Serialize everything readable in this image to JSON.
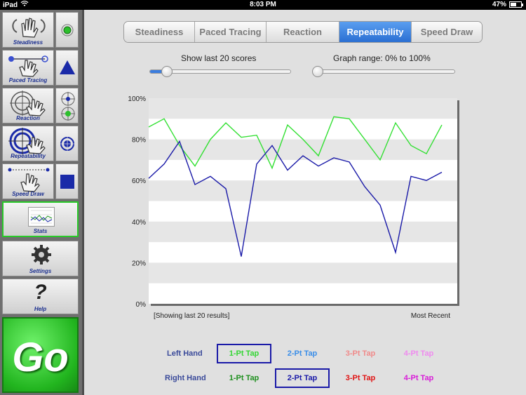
{
  "statusbar": {
    "device": "iPad",
    "time": "8:03 PM",
    "battery": "47%",
    "battery_level": 0.47
  },
  "sidebar": {
    "steadiness_label": "Steadiness",
    "paced_tracing_label": "Paced Tracing",
    "reaction_label": "Reaction",
    "repeatability_label": "Repeatability",
    "speed_draw_label": "Speed Draw",
    "stats_label": "Stats",
    "settings_label": "Settings",
    "help_label": "Help",
    "help_glyph": "?",
    "go_label": "Go"
  },
  "tabs": [
    {
      "label": "Steadiness",
      "active": false
    },
    {
      "label": "Paced Tracing",
      "active": false
    },
    {
      "label": "Reaction",
      "active": false
    },
    {
      "label": "Repeatability",
      "active": true
    },
    {
      "label": "Speed Draw",
      "active": false
    }
  ],
  "sliders": {
    "scores": {
      "label": "Show last 20 scores",
      "value": 0.12
    },
    "range": {
      "label": "Graph range: 0% to 100%",
      "value": 0.0
    }
  },
  "chart_data": {
    "type": "line",
    "ylim": [
      0,
      100
    ],
    "y_ticks": [
      "0%",
      "20%",
      "40%",
      "60%",
      "80%",
      "100%"
    ],
    "footer_left": "[Showing last 20 results]",
    "footer_right": "Most Recent",
    "x": [
      1,
      2,
      3,
      4,
      5,
      6,
      7,
      8,
      9,
      10,
      11,
      12,
      13,
      14,
      15,
      16,
      17,
      18,
      19,
      20,
      21
    ],
    "series": [
      {
        "color": "#33e033",
        "values": [
          86,
          90,
          77,
          67,
          80,
          88,
          81,
          82,
          66,
          87,
          80,
          72,
          91,
          90,
          80,
          70,
          88,
          77,
          73,
          87
        ]
      },
      {
        "color": "#1a1aa8",
        "values": [
          61,
          68,
          79,
          58,
          62,
          56,
          23,
          68,
          77,
          65,
          72,
          67,
          71,
          69,
          57,
          48,
          25,
          62,
          60,
          64
        ]
      }
    ]
  },
  "legend": {
    "left_hand_label": "Left Hand",
    "right_hand_label": "Right Hand",
    "left": [
      {
        "label": "1-Pt Tap",
        "color": "#33d633",
        "selected": true
      },
      {
        "label": "2-Pt Tap",
        "color": "#3a8ee8",
        "selected": false
      },
      {
        "label": "3-Pt Tap",
        "color": "#f08a8a",
        "selected": false
      },
      {
        "label": "4-Pt Tap",
        "color": "#ef8aef",
        "selected": false
      }
    ],
    "right": [
      {
        "label": "1-Pt Tap",
        "color": "#1e8f1e",
        "selected": false
      },
      {
        "label": "2-Pt Tap",
        "color": "#1a1aa8",
        "selected": true
      },
      {
        "label": "3-Pt Tap",
        "color": "#e01515",
        "selected": false
      },
      {
        "label": "4-Pt Tap",
        "color": "#d81bd8",
        "selected": false
      }
    ]
  }
}
